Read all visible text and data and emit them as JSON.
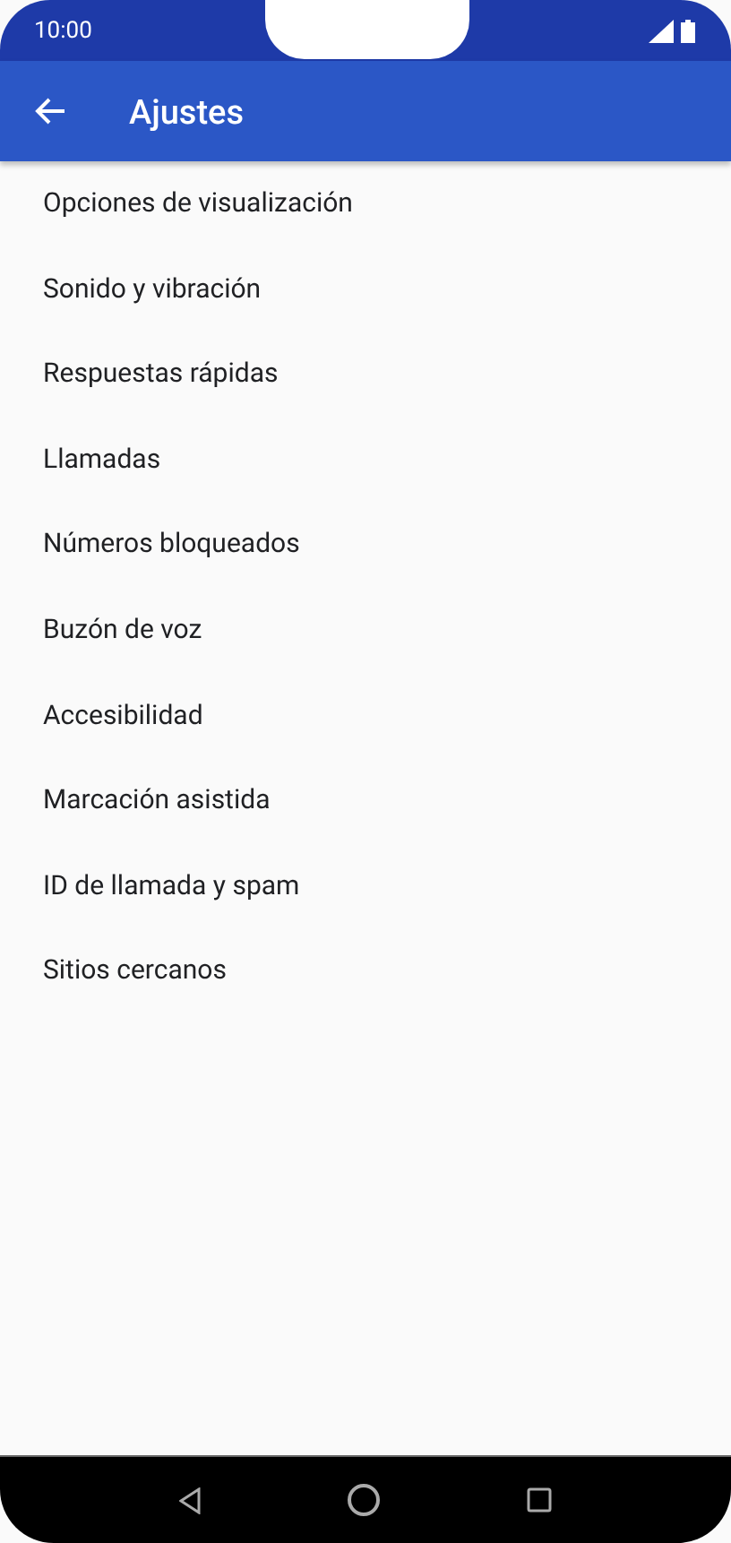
{
  "status_bar": {
    "time": "10:00"
  },
  "app_bar": {
    "title": "Ajustes"
  },
  "settings": [
    {
      "label": "Opciones de visualización"
    },
    {
      "label": "Sonido y vibración"
    },
    {
      "label": "Respuestas rápidas"
    },
    {
      "label": "Llamadas"
    },
    {
      "label": "Números bloqueados"
    },
    {
      "label": "Buzón de voz"
    },
    {
      "label": "Accesibilidad"
    },
    {
      "label": "Marcación asistida"
    },
    {
      "label": "ID de llamada y spam"
    },
    {
      "label": "Sitios cercanos"
    }
  ]
}
